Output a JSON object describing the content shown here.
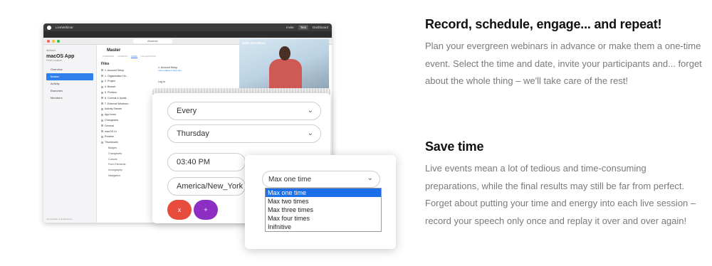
{
  "app": {
    "brand": "LiveWebinar",
    "topbar_right": [
      "Invite",
      "Test",
      "Dashboard"
    ],
    "address": "Abstract",
    "counter": "00 : 04 : 27 : 33"
  },
  "sidebar": {
    "workspace": "Abstract",
    "app_name": "macOS App",
    "app_sub": "Final Location",
    "items": [
      {
        "label": "Overview"
      },
      {
        "label": "Master"
      },
      {
        "label": "Activity"
      },
      {
        "label": "Branches"
      },
      {
        "label": "Members"
      }
    ],
    "footer": "Final Details & Notifications"
  },
  "main": {
    "title": "Master",
    "tabs": [
      "OVERVIEW",
      "COMMITS",
      "FILES",
      "COLLECTIONS"
    ],
    "files_heading": "Files",
    "files": [
      "1. Account Setup",
      "1. Organization Ho...",
      "2. Project",
      "4. Branch",
      "5. Preview",
      "6. Commit & Updat...",
      "7. External Windows...",
      "Activity Stream",
      "App Icons",
      "Changesets",
      "General",
      "macOS UI",
      "Preview",
      "Thumbnails"
    ],
    "files_sub": [
      "Badges",
      "Changesets",
      "Cursors",
      "Form Elements",
      "Iconography",
      "Navigation",
      "Notification"
    ],
    "right_item": "1. Account Setup",
    "right_sub": "Last updated 2 days ago",
    "right_item2": "Log In"
  },
  "video": {
    "participant": "John Goodbow"
  },
  "schedule": {
    "repeat": "Every",
    "day": "Thursday",
    "time": "03:40 PM",
    "timezone": "America/New_York",
    "remove_label": "x",
    "add_label": "+"
  },
  "dropdown": {
    "selected": "Max one time",
    "options": [
      "Max one time",
      "Max two times",
      "Max three times",
      "Max four times",
      "Inifnitive"
    ]
  },
  "content": {
    "heading1": "Record, schedule, engage... and repeat!",
    "para1": "Plan your evergreen webinars in advance or make them a one-time event. Select the time and date, invite your participants and... forget about the whole thing – we'll take care of the rest!",
    "heading2": "Save time",
    "para2": "Live events mean a lot of tedious and time-consuming preparations, while the final results may still be far from perfect. Forget about putting your time and energy into each live session – record your speech only once and replay it over and over again!"
  },
  "colors": {
    "accent_blue": "#2f80ed",
    "remove_red": "#e74c3c",
    "add_purple": "#8e2fc4",
    "selected_option": "#1a6ee8"
  }
}
